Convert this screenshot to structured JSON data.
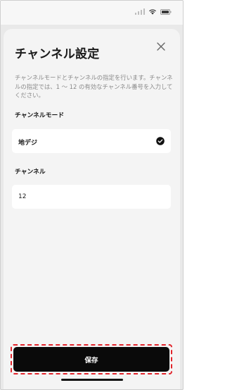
{
  "status_bar": {
    "icons": [
      "signal-icon",
      "wifi-icon",
      "battery-icon"
    ]
  },
  "sheet": {
    "title": "チャンネル設定",
    "close_icon": "close-icon",
    "description": "チャンネルモードとチャンネルの指定を行います。チャンネルの指定では、1 〜 12 の有効なチャンネル番号を入力してください。"
  },
  "mode": {
    "label": "チャンネルモード",
    "selected_value": "地デジ",
    "selected_icon": "check-circle-icon"
  },
  "channel": {
    "label": "チャンネル",
    "value": "12"
  },
  "footer": {
    "save_label": "保存",
    "highlight_color": "#e1242b"
  },
  "colors": {
    "sheet_background": "#f4f4f4",
    "field_background": "#ffffff",
    "button_background": "#0a0a0a",
    "button_text": "#ffffff"
  }
}
